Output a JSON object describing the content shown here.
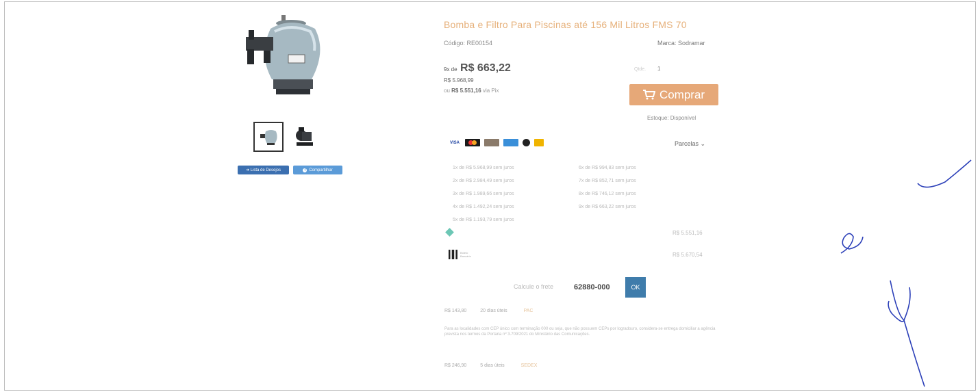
{
  "product": {
    "title": "Bomba e Filtro Para Piscinas até 156 Mil Litros FMS 70",
    "code_label": "Código: RE00154",
    "brand_label": "Marca: Sodramar"
  },
  "pricing": {
    "installment_prefix": "9x de",
    "installment_value": "R$ 663,22",
    "full_price": "R$ 5.968,99",
    "cash_prefix": "ou",
    "cash_value": "R$ 5.551,16",
    "cash_suffix": "via Pix"
  },
  "purchase": {
    "qty_label": "Qtde.",
    "qty_value": "1",
    "buy_label": "Comprar",
    "stock_label": "Estoque: Disponível"
  },
  "gallery": {
    "wishlist_label": "➜ Lista de Desejos",
    "share_label": "Compartilhar"
  },
  "payment": {
    "cards": [
      "visa",
      "mastercard",
      "diners",
      "amex",
      "elo",
      "hipercard"
    ],
    "parcelas_label": "Parcelas",
    "installments_col1": [
      "1x de R$ 5.968,99 sem juros",
      "2x de R$ 2.984,49 sem juros",
      "3x de R$ 1.989,66 sem juros",
      "4x de R$ 1.492,24 sem juros",
      "5x de R$ 1.193,79 sem juros"
    ],
    "installments_col2": [
      "6x de R$ 994,83 sem juros",
      "7x de R$ 852,71 sem juros",
      "8x de R$ 746,12 sem juros",
      "9x de R$ 663,22 sem juros"
    ],
    "pix_price": "R$ 5.551,16",
    "boleto_text": "Boleto Bancário",
    "boleto_price": "R$ 5.670,54"
  },
  "shipping": {
    "calc_label": "Calcule o frete",
    "cep_value": "62880-000",
    "ok_label": "OK",
    "option1": {
      "price": "R$ 143,80",
      "days": "20 dias úteis",
      "service": "PAC"
    },
    "note": "Para as localidades com CEP único com terminação 000 ou seja, que não possuem CEPs por logradouro, considera-se entrega domiciliar a agência prevista nos termos da Portaria nº 3.709/2021 do Ministério das Comunicações.",
    "option2": {
      "price": "R$ 246,90",
      "days": "5 dias úteis",
      "service": "SEDEX"
    }
  },
  "colors": {
    "accent": "#e6a878",
    "title": "#e6b07a",
    "ok_button": "#3f7cab",
    "signature_ink": "#2b3fb8"
  }
}
